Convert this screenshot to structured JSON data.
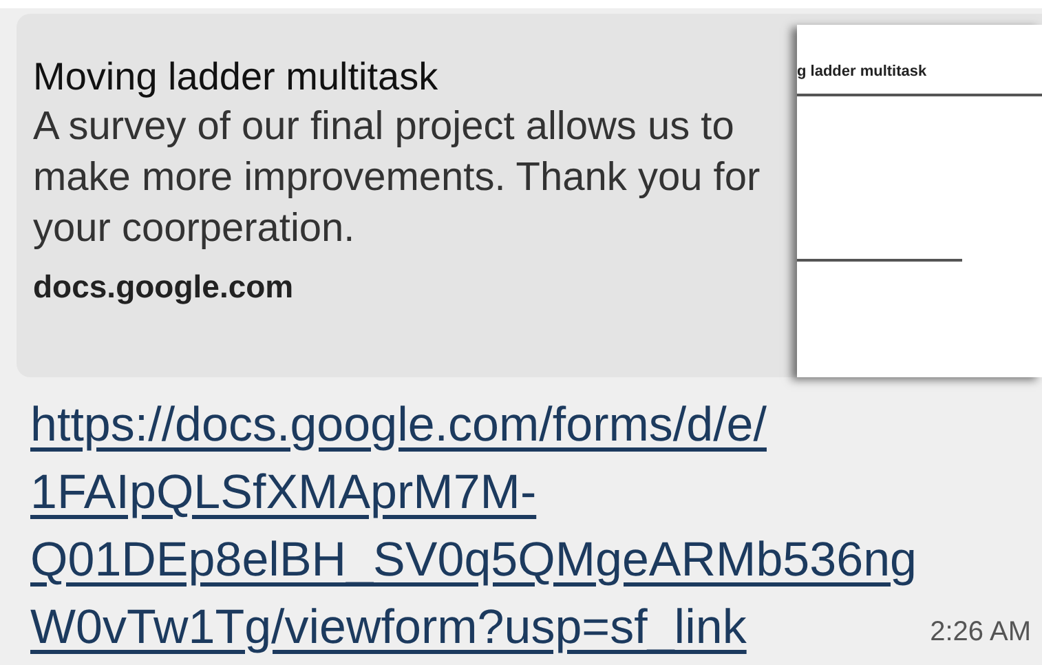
{
  "preview": {
    "title": "Moving ladder multitask",
    "description": "A survey of our final project allows us to make more improvements. Thank you for your coorperation.",
    "domain": "docs.google.com",
    "thumbnail": {
      "title": "g ladder multitask"
    }
  },
  "link_lines": [
    "https://docs.google.com/forms/d/e/",
    "1FAIpQLSfXMAprM7M-",
    "Q01DEp8elBH_SV0q5QMgeARMb536ng",
    "W0vTw1Tg/viewform?usp=sf_link"
  ],
  "time": "2:26 AM"
}
